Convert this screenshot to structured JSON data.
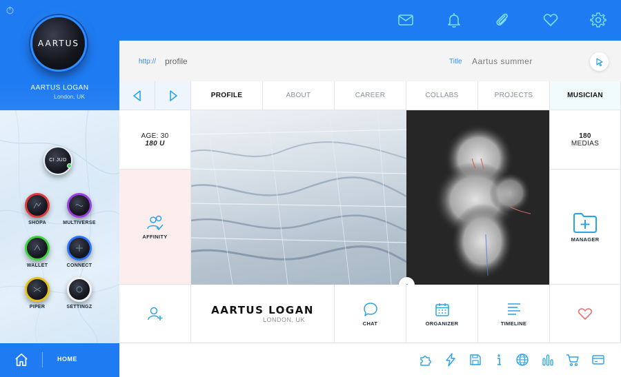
{
  "sidebar": {
    "logo_text": "AARTUS",
    "user_name": "AARTUS LOGAN",
    "user_location": "London, UK",
    "center_orb_label": "CI JUD",
    "apps": [
      {
        "label": "SHOPA",
        "ring": "#e23a3a"
      },
      {
        "label": "MULTIVERSE",
        "ring": "#9b3fe0"
      },
      {
        "label": "WALLET",
        "ring": "#3fd43f"
      },
      {
        "label": "CONNECT",
        "ring": "#2d72ff"
      },
      {
        "label": "PIPER",
        "ring": "#e6c20f"
      },
      {
        "label": "SETTINGZ",
        "ring": "#f1f1f1"
      }
    ],
    "home_label": "HOME"
  },
  "url_bar": {
    "prefix": "http://",
    "path": "profile",
    "title_label": "Title",
    "title_value": "Aartus summer"
  },
  "tabs": [
    "PROFILE",
    "ABOUT",
    "CAREER",
    "COLLABS",
    "PROJECTS",
    "MUSICIAN"
  ],
  "profile": {
    "age": "AGE: 30",
    "units": "180 U",
    "medias_count": "180",
    "medias_label": "MEDIAS",
    "affinity_label": "AFFINITY",
    "manager_label": "MANAGER",
    "brand_name": "AARTUS LOGAN",
    "brand_location": "LONDON, UK",
    "chat_label": "CHAT",
    "organizer_label": "ORGANIZER",
    "timeline_label": "TIMELINE"
  },
  "colors": {
    "primary": "#1e7bf2",
    "icon_blue": "#29a3e8",
    "heart_red": "#f07070",
    "affinity_bg": "#fdeeee"
  },
  "icons": {
    "top": [
      "mail-icon",
      "bell-icon",
      "paperclip-icon",
      "heart-icon",
      "gear-icon"
    ],
    "bottom": [
      "puzzle-icon",
      "bolt-icon",
      "save-icon",
      "info-icon",
      "globe-icon",
      "bar-chart-icon",
      "cart-icon",
      "card-icon"
    ]
  }
}
